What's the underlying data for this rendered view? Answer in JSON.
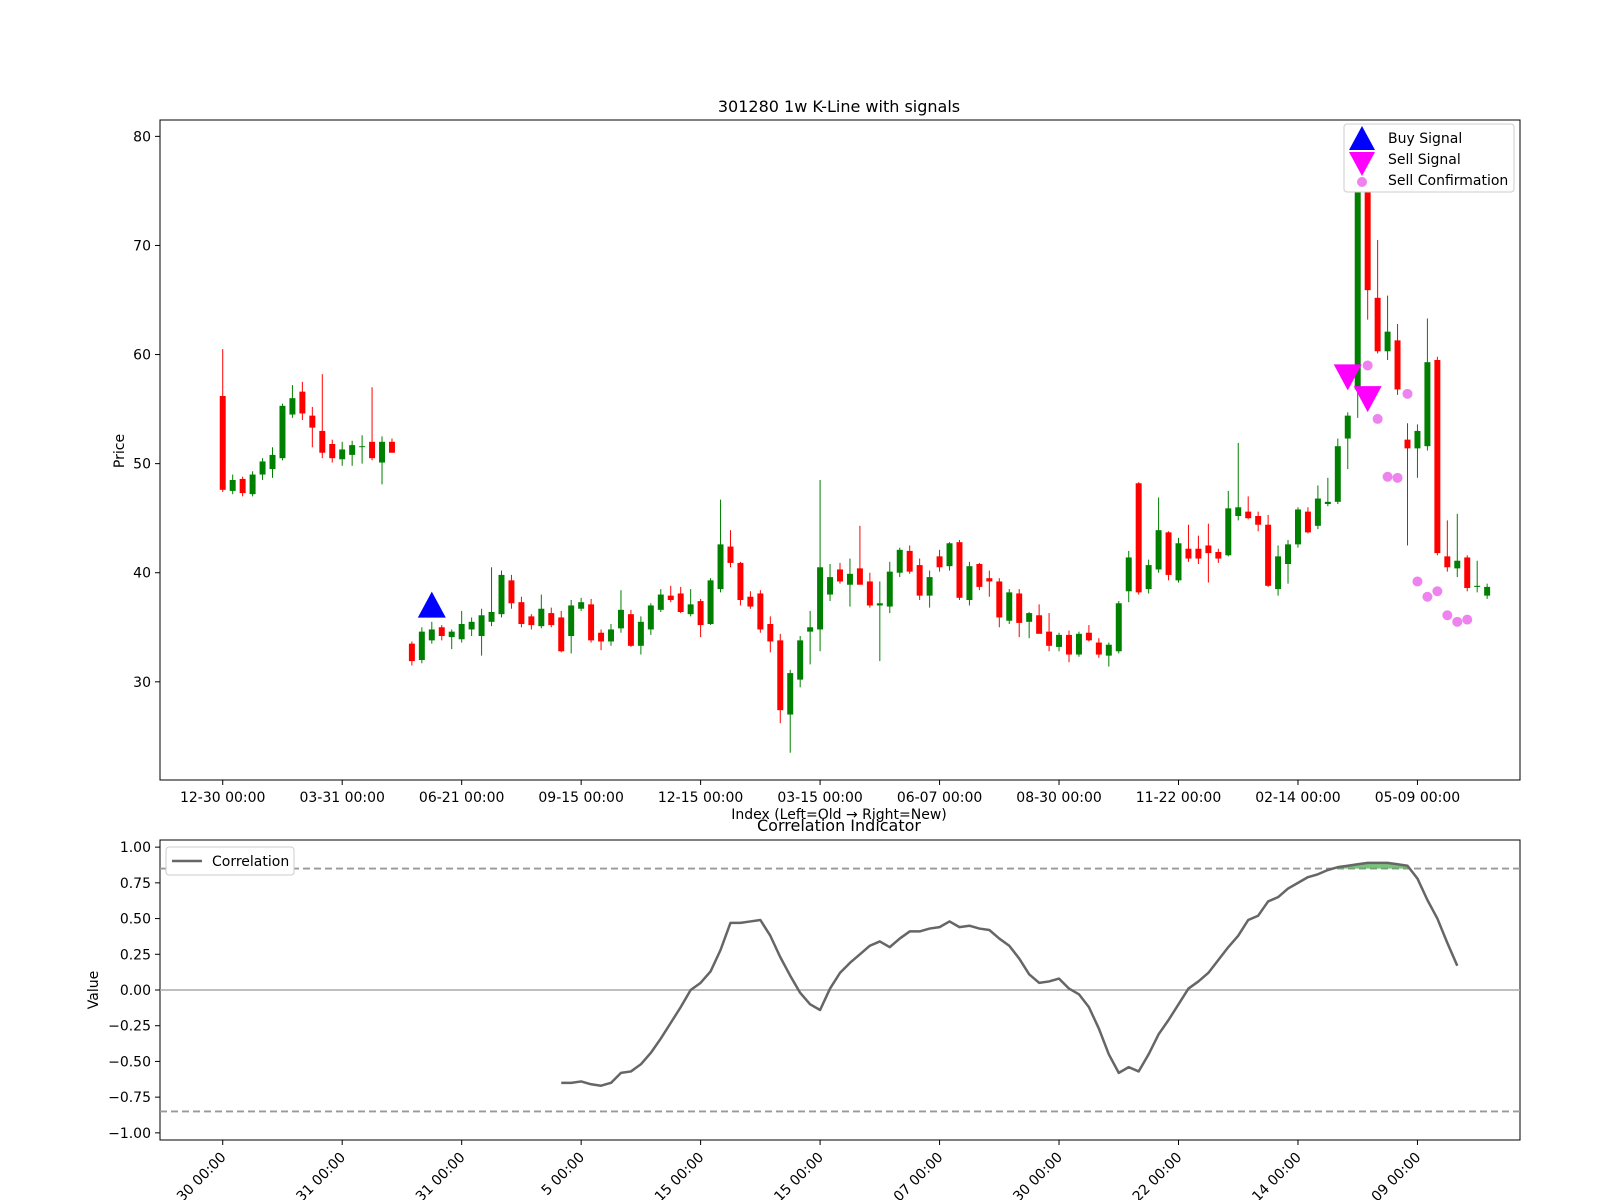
{
  "chart_data": [
    {
      "type": "candlestick",
      "title": "301280 1w K-Line with signals",
      "xlabel": "Index (Left=Old → Right=New)",
      "ylabel": "Price",
      "ylim": [
        21,
        81.5
      ],
      "yticks": [
        30,
        40,
        50,
        60,
        70,
        80
      ],
      "xtick_labels": [
        "12-30 00:00",
        "03-31 00:00",
        "06-21 00:00",
        "09-15 00:00",
        "12-15 00:00",
        "03-15 00:00",
        "06-07 00:00",
        "08-30 00:00",
        "11-22 00:00",
        "02-14 00:00",
        "05-09 00:00"
      ],
      "xtick_index": [
        0,
        12,
        24,
        36,
        48,
        60,
        72,
        84,
        96,
        108,
        120
      ],
      "xlim": [
        -6.3,
        130.3
      ],
      "legend_position": "top-right",
      "legend": [
        "Buy Signal",
        "Sell Signal",
        "Sell Confirmation"
      ],
      "colors": {
        "up": "#008000",
        "down": "#ff0000",
        "buy": "#0000ff",
        "sell": "#ff00ff",
        "confirm": "#ee82ee"
      },
      "candles": [
        [
          56.2,
          60.5,
          47.4,
          47.6
        ],
        [
          47.5,
          49.0,
          47.2,
          48.5
        ],
        [
          48.6,
          48.8,
          47.0,
          47.3
        ],
        [
          47.2,
          49.3,
          47.0,
          49.0
        ],
        [
          49.0,
          50.5,
          48.5,
          50.2
        ],
        [
          49.5,
          51.5,
          48.7,
          50.8
        ],
        [
          50.5,
          55.5,
          50.3,
          55.3
        ],
        [
          54.5,
          57.2,
          54.2,
          56.0
        ],
        [
          56.6,
          57.5,
          54.0,
          54.6
        ],
        [
          54.4,
          55.2,
          51.5,
          53.3
        ],
        [
          53.0,
          58.2,
          50.5,
          51.0
        ],
        [
          51.8,
          52.2,
          50.1,
          50.5
        ],
        [
          50.4,
          52.0,
          49.8,
          51.3
        ],
        [
          50.8,
          52.1,
          49.8,
          51.7
        ],
        [
          51.6,
          52.6,
          50.0,
          51.6
        ],
        [
          52.0,
          57.0,
          50.3,
          50.5
        ],
        [
          50.1,
          52.5,
          48.1,
          52.0
        ],
        [
          52.0,
          52.3,
          51.2,
          51.0
        ],
        null,
        [
          33.5,
          33.7,
          31.5,
          31.9
        ],
        [
          32.0,
          35.0,
          31.7,
          34.6
        ],
        [
          33.8,
          35.5,
          33.5,
          34.8
        ],
        [
          35.0,
          35.2,
          33.8,
          34.2
        ],
        [
          34.1,
          34.8,
          33.0,
          34.6
        ],
        [
          33.9,
          36.5,
          33.6,
          35.3
        ],
        [
          34.8,
          35.9,
          34.2,
          35.5
        ],
        [
          34.2,
          36.7,
          32.4,
          36.1
        ],
        [
          35.5,
          40.5,
          35.1,
          36.4
        ],
        [
          36.2,
          40.2,
          35.9,
          39.8
        ],
        [
          39.3,
          39.8,
          36.7,
          37.2
        ],
        [
          37.3,
          37.8,
          35.0,
          35.3
        ],
        [
          36.0,
          36.2,
          34.8,
          35.2
        ],
        [
          35.1,
          38.0,
          34.9,
          36.7
        ],
        [
          36.3,
          36.8,
          35.0,
          35.2
        ],
        [
          35.9,
          36.5,
          32.7,
          32.8
        ],
        [
          34.2,
          37.5,
          32.6,
          37.0
        ],
        [
          36.7,
          37.7,
          36.5,
          37.3
        ],
        [
          37.1,
          37.6,
          33.6,
          33.8
        ],
        [
          34.5,
          34.8,
          32.9,
          33.7
        ],
        [
          33.7,
          35.3,
          33.3,
          34.8
        ],
        [
          34.9,
          38.4,
          34.5,
          36.6
        ],
        [
          36.2,
          36.6,
          33.2,
          33.3
        ],
        [
          33.3,
          36.0,
          32.5,
          35.5
        ],
        [
          34.8,
          37.2,
          34.3,
          37.0
        ],
        [
          36.6,
          38.5,
          36.4,
          38.0
        ],
        [
          37.9,
          38.8,
          37.3,
          37.5
        ],
        [
          38.1,
          38.7,
          36.3,
          36.4
        ],
        [
          36.2,
          38.5,
          36.0,
          37.1
        ],
        [
          37.4,
          37.6,
          34.1,
          35.2
        ],
        [
          35.3,
          39.5,
          35.2,
          39.3
        ],
        [
          38.5,
          46.7,
          38.2,
          42.6
        ],
        [
          42.4,
          43.9,
          40.5,
          40.9
        ],
        [
          40.9,
          41.0,
          37.0,
          37.5
        ],
        [
          37.8,
          38.3,
          36.7,
          36.9
        ],
        [
          38.1,
          38.4,
          34.5,
          34.8
        ],
        [
          35.3,
          36.0,
          32.7,
          33.7
        ],
        [
          33.8,
          34.4,
          26.2,
          27.4
        ],
        [
          27.0,
          31.1,
          23.5,
          30.8
        ],
        [
          30.2,
          34.2,
          29.5,
          33.8
        ],
        [
          34.6,
          36.5,
          31.6,
          35.0
        ],
        [
          34.8,
          48.5,
          32.8,
          40.5
        ],
        [
          38.0,
          40.8,
          37.4,
          39.6
        ],
        [
          40.3,
          40.9,
          39.0,
          39.2
        ],
        [
          38.9,
          41.3,
          36.9,
          39.9
        ],
        [
          40.4,
          44.3,
          39.1,
          38.9
        ],
        [
          39.2,
          40.0,
          36.8,
          37.0
        ],
        [
          37.0,
          39.2,
          31.9,
          37.2
        ],
        [
          36.9,
          41.0,
          36.3,
          40.1
        ],
        [
          40.0,
          42.3,
          39.6,
          42.1
        ],
        [
          42.0,
          42.5,
          39.9,
          40.1
        ],
        [
          40.7,
          41.3,
          37.5,
          37.9
        ],
        [
          37.9,
          40.2,
          36.8,
          39.6
        ],
        [
          41.5,
          42.1,
          40.1,
          40.5
        ],
        [
          40.6,
          42.8,
          40.2,
          42.7
        ],
        [
          42.8,
          43.0,
          37.5,
          37.7
        ],
        [
          37.5,
          41.0,
          37.0,
          40.6
        ],
        [
          40.8,
          40.9,
          38.4,
          38.7
        ],
        [
          39.5,
          40.2,
          37.8,
          39.2
        ],
        [
          39.2,
          39.5,
          35.0,
          35.9
        ],
        [
          35.6,
          38.5,
          35.3,
          38.2
        ],
        [
          38.1,
          38.5,
          34.1,
          35.4
        ],
        [
          35.5,
          36.4,
          34.0,
          36.3
        ],
        [
          36.1,
          37.1,
          34.5,
          34.4
        ],
        [
          34.6,
          36.3,
          32.8,
          33.3
        ],
        [
          33.2,
          34.5,
          32.8,
          34.3
        ],
        [
          34.3,
          34.7,
          31.8,
          32.5
        ],
        [
          32.5,
          34.6,
          32.3,
          34.4
        ],
        [
          34.5,
          35.2,
          33.7,
          33.8
        ],
        [
          33.6,
          34.0,
          32.2,
          32.5
        ],
        [
          32.4,
          33.6,
          31.4,
          33.4
        ],
        [
          32.8,
          37.4,
          32.6,
          37.2
        ],
        [
          38.3,
          42.0,
          37.3,
          41.4
        ],
        [
          48.2,
          48.3,
          38.0,
          38.2
        ],
        [
          38.5,
          41.2,
          38.1,
          40.7
        ],
        [
          40.3,
          46.9,
          40.0,
          43.9
        ],
        [
          43.7,
          43.8,
          39.3,
          39.8
        ],
        [
          39.3,
          43.2,
          39.1,
          42.7
        ],
        [
          42.2,
          44.4,
          41.0,
          41.3
        ],
        [
          42.2,
          43.4,
          40.8,
          41.3
        ],
        [
          42.5,
          44.5,
          39.1,
          41.8
        ],
        [
          41.9,
          42.2,
          40.9,
          41.3
        ],
        [
          41.6,
          47.5,
          41.5,
          45.9
        ],
        [
          45.2,
          51.9,
          44.8,
          46.0
        ],
        [
          45.6,
          47.0,
          44.9,
          45.0
        ],
        [
          45.2,
          45.6,
          43.8,
          44.4
        ],
        [
          44.4,
          45.3,
          38.7,
          38.8
        ],
        [
          38.5,
          42.5,
          37.9,
          41.5
        ],
        [
          40.8,
          43.0,
          39.0,
          42.6
        ],
        [
          42.6,
          46.0,
          42.3,
          45.8
        ],
        [
          45.6,
          46.0,
          43.6,
          43.7
        ],
        [
          44.3,
          48.0,
          44.0,
          46.8
        ],
        [
          46.3,
          48.7,
          46.1,
          46.5
        ],
        [
          46.5,
          52.3,
          46.3,
          51.6
        ],
        [
          52.3,
          54.7,
          49.5,
          54.4
        ],
        [
          56.8,
          78.5,
          54.2,
          76.9
        ],
        [
          75.5,
          75.6,
          63.2,
          65.9
        ],
        [
          65.2,
          70.5,
          60.1,
          60.3
        ],
        [
          60.3,
          65.4,
          59.5,
          62.1
        ],
        [
          61.3,
          62.8,
          56.3,
          56.8
        ],
        [
          52.2,
          53.7,
          42.5,
          51.4
        ],
        [
          51.4,
          53.6,
          48.7,
          53.0
        ],
        [
          51.6,
          63.3,
          51.2,
          59.3
        ],
        [
          59.5,
          59.8,
          41.6,
          41.8
        ],
        [
          41.5,
          44.8,
          40.1,
          40.5
        ],
        [
          40.4,
          45.4,
          39.6,
          41.1
        ],
        [
          41.4,
          41.6,
          38.3,
          38.6
        ],
        [
          38.7,
          41.1,
          38.2,
          38.8
        ],
        [
          37.9,
          39.0,
          37.6,
          38.7
        ]
      ],
      "buy_signals": [
        {
          "index": 21,
          "price": 36.8
        }
      ],
      "sell_signals": [
        {
          "index": 113,
          "price": 58.0
        },
        {
          "index": 115,
          "price": 56.0
        }
      ],
      "sell_confirmations": [
        {
          "index": 115,
          "price": 59.0
        },
        {
          "index": 116,
          "price": 54.1
        },
        {
          "index": 117,
          "price": 48.8
        },
        {
          "index": 118,
          "price": 48.7
        },
        {
          "index": 119,
          "price": 56.4
        },
        {
          "index": 120,
          "price": 39.2
        },
        {
          "index": 121,
          "price": 37.8
        },
        {
          "index": 122,
          "price": 38.3
        },
        {
          "index": 123,
          "price": 36.1
        },
        {
          "index": 124,
          "price": 35.5
        },
        {
          "index": 125,
          "price": 35.7
        }
      ]
    },
    {
      "type": "line",
      "title": "Correlation Indicator",
      "xlabel": "",
      "ylabel": "Value",
      "ylim": [
        -1.05,
        1.05
      ],
      "yticks": [
        1.0,
        0.75,
        0.5,
        0.25,
        0.0,
        -0.25,
        -0.5,
        -0.75,
        -1.0
      ],
      "ytick_labels": [
        "1.00",
        "0.75",
        "0.50",
        "0.25",
        "0.00",
        "−0.25",
        "−0.50",
        "−0.75",
        "−1.00"
      ],
      "xtick_labels": [
        "30 00:00",
        "31 00:00",
        "31 00:00",
        "5 00:00",
        "15 00:00",
        "15 00:00",
        "07 00:00",
        "30 00:00",
        "22 00:00",
        "14 00:00",
        "09 00:00"
      ],
      "xtick_index": [
        0,
        12,
        24,
        36,
        48,
        60,
        72,
        84,
        96,
        108,
        120
      ],
      "xlim": [
        -6.3,
        130.3
      ],
      "thresholds": [
        0.85,
        -0.85
      ],
      "legend": [
        "Correlation"
      ],
      "legend_position": "top-left",
      "colors": {
        "line": "#666666",
        "threshold": "#999999",
        "zero": "#aaaaaa",
        "fill": "#4caf50"
      },
      "series": [
        {
          "name": "Correlation",
          "start_index": 34,
          "values": [
            -0.65,
            -0.65,
            -0.64,
            -0.66,
            -0.67,
            -0.65,
            -0.58,
            -0.57,
            -0.52,
            -0.44,
            -0.34,
            -0.23,
            -0.12,
            0.0,
            0.05,
            0.13,
            0.28,
            0.47,
            0.47,
            0.48,
            0.49,
            0.38,
            0.23,
            0.1,
            -0.02,
            -0.1,
            -0.14,
            0.01,
            0.12,
            0.19,
            0.25,
            0.31,
            0.34,
            0.3,
            0.36,
            0.41,
            0.41,
            0.43,
            0.44,
            0.48,
            0.44,
            0.45,
            0.43,
            0.42,
            0.36,
            0.31,
            0.22,
            0.11,
            0.05,
            0.06,
            0.08,
            0.01,
            -0.03,
            -0.12,
            -0.27,
            -0.45,
            -0.58,
            -0.54,
            -0.57,
            -0.45,
            -0.31,
            -0.21,
            -0.1,
            0.01,
            0.06,
            0.12,
            0.21,
            0.3,
            0.38,
            0.49,
            0.52,
            0.62,
            0.65,
            0.71,
            0.75,
            0.79,
            0.81,
            0.84,
            0.86,
            0.87,
            0.88,
            0.89,
            0.89,
            0.89,
            0.88,
            0.87,
            0.78,
            0.63,
            0.5,
            0.33,
            0.17
          ]
        }
      ]
    }
  ]
}
